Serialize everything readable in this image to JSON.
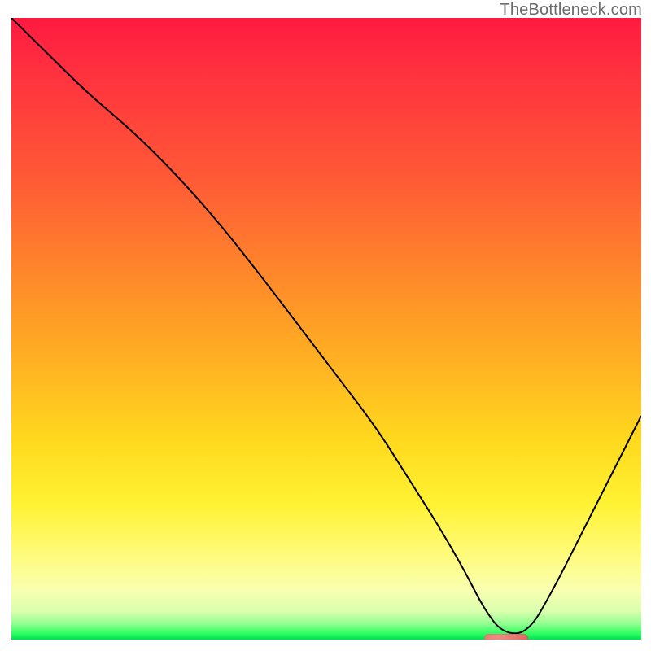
{
  "watermark": "TheBottleneck.com",
  "chart_data": {
    "type": "line",
    "title": "",
    "xlabel": "",
    "ylabel": "",
    "xlim": [
      0,
      100
    ],
    "ylim": [
      0,
      100
    ],
    "grid": false,
    "legend": false,
    "background_gradient": {
      "orientation": "vertical",
      "stops": [
        {
          "pos": 0,
          "color": "#ff1a40"
        },
        {
          "pos": 26,
          "color": "#ff5a36"
        },
        {
          "pos": 56,
          "color": "#ffb322"
        },
        {
          "pos": 78,
          "color": "#fff232"
        },
        {
          "pos": 95,
          "color": "#d9ffae"
        },
        {
          "pos": 100,
          "color": "#00e050"
        }
      ]
    },
    "series": [
      {
        "name": "bottleneck-curve",
        "color": "#000000",
        "x": [
          0,
          6,
          12,
          19,
          26,
          33,
          40,
          46,
          52,
          58,
          63,
          68,
          72,
          75,
          78,
          82,
          86,
          90,
          94,
          98,
          100
        ],
        "y": [
          100,
          94,
          88,
          82,
          75,
          67,
          58,
          50,
          42,
          34,
          26,
          18,
          11,
          5,
          1,
          1,
          8,
          16,
          24,
          32,
          36
        ]
      }
    ],
    "marker": {
      "name": "optimal-range",
      "shape": "pill",
      "color": "#e4766d",
      "x_start": 75,
      "x_end": 82,
      "y": 0.3
    }
  }
}
